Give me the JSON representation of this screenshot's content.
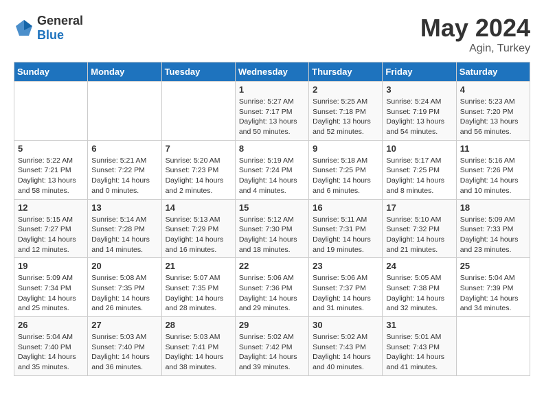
{
  "header": {
    "logo_general": "General",
    "logo_blue": "Blue",
    "title": "May 2024",
    "location": "Agin, Turkey"
  },
  "days_of_week": [
    "Sunday",
    "Monday",
    "Tuesday",
    "Wednesday",
    "Thursday",
    "Friday",
    "Saturday"
  ],
  "weeks": [
    [
      {
        "day": "",
        "sunrise": "",
        "sunset": "",
        "daylight": ""
      },
      {
        "day": "",
        "sunrise": "",
        "sunset": "",
        "daylight": ""
      },
      {
        "day": "",
        "sunrise": "",
        "sunset": "",
        "daylight": ""
      },
      {
        "day": "1",
        "sunrise": "Sunrise: 5:27 AM",
        "sunset": "Sunset: 7:17 PM",
        "daylight": "Daylight: 13 hours and 50 minutes."
      },
      {
        "day": "2",
        "sunrise": "Sunrise: 5:25 AM",
        "sunset": "Sunset: 7:18 PM",
        "daylight": "Daylight: 13 hours and 52 minutes."
      },
      {
        "day": "3",
        "sunrise": "Sunrise: 5:24 AM",
        "sunset": "Sunset: 7:19 PM",
        "daylight": "Daylight: 13 hours and 54 minutes."
      },
      {
        "day": "4",
        "sunrise": "Sunrise: 5:23 AM",
        "sunset": "Sunset: 7:20 PM",
        "daylight": "Daylight: 13 hours and 56 minutes."
      }
    ],
    [
      {
        "day": "5",
        "sunrise": "Sunrise: 5:22 AM",
        "sunset": "Sunset: 7:21 PM",
        "daylight": "Daylight: 13 hours and 58 minutes."
      },
      {
        "day": "6",
        "sunrise": "Sunrise: 5:21 AM",
        "sunset": "Sunset: 7:22 PM",
        "daylight": "Daylight: 14 hours and 0 minutes."
      },
      {
        "day": "7",
        "sunrise": "Sunrise: 5:20 AM",
        "sunset": "Sunset: 7:23 PM",
        "daylight": "Daylight: 14 hours and 2 minutes."
      },
      {
        "day": "8",
        "sunrise": "Sunrise: 5:19 AM",
        "sunset": "Sunset: 7:24 PM",
        "daylight": "Daylight: 14 hours and 4 minutes."
      },
      {
        "day": "9",
        "sunrise": "Sunrise: 5:18 AM",
        "sunset": "Sunset: 7:25 PM",
        "daylight": "Daylight: 14 hours and 6 minutes."
      },
      {
        "day": "10",
        "sunrise": "Sunrise: 5:17 AM",
        "sunset": "Sunset: 7:25 PM",
        "daylight": "Daylight: 14 hours and 8 minutes."
      },
      {
        "day": "11",
        "sunrise": "Sunrise: 5:16 AM",
        "sunset": "Sunset: 7:26 PM",
        "daylight": "Daylight: 14 hours and 10 minutes."
      }
    ],
    [
      {
        "day": "12",
        "sunrise": "Sunrise: 5:15 AM",
        "sunset": "Sunset: 7:27 PM",
        "daylight": "Daylight: 14 hours and 12 minutes."
      },
      {
        "day": "13",
        "sunrise": "Sunrise: 5:14 AM",
        "sunset": "Sunset: 7:28 PM",
        "daylight": "Daylight: 14 hours and 14 minutes."
      },
      {
        "day": "14",
        "sunrise": "Sunrise: 5:13 AM",
        "sunset": "Sunset: 7:29 PM",
        "daylight": "Daylight: 14 hours and 16 minutes."
      },
      {
        "day": "15",
        "sunrise": "Sunrise: 5:12 AM",
        "sunset": "Sunset: 7:30 PM",
        "daylight": "Daylight: 14 hours and 18 minutes."
      },
      {
        "day": "16",
        "sunrise": "Sunrise: 5:11 AM",
        "sunset": "Sunset: 7:31 PM",
        "daylight": "Daylight: 14 hours and 19 minutes."
      },
      {
        "day": "17",
        "sunrise": "Sunrise: 5:10 AM",
        "sunset": "Sunset: 7:32 PM",
        "daylight": "Daylight: 14 hours and 21 minutes."
      },
      {
        "day": "18",
        "sunrise": "Sunrise: 5:09 AM",
        "sunset": "Sunset: 7:33 PM",
        "daylight": "Daylight: 14 hours and 23 minutes."
      }
    ],
    [
      {
        "day": "19",
        "sunrise": "Sunrise: 5:09 AM",
        "sunset": "Sunset: 7:34 PM",
        "daylight": "Daylight: 14 hours and 25 minutes."
      },
      {
        "day": "20",
        "sunrise": "Sunrise: 5:08 AM",
        "sunset": "Sunset: 7:35 PM",
        "daylight": "Daylight: 14 hours and 26 minutes."
      },
      {
        "day": "21",
        "sunrise": "Sunrise: 5:07 AM",
        "sunset": "Sunset: 7:35 PM",
        "daylight": "Daylight: 14 hours and 28 minutes."
      },
      {
        "day": "22",
        "sunrise": "Sunrise: 5:06 AM",
        "sunset": "Sunset: 7:36 PM",
        "daylight": "Daylight: 14 hours and 29 minutes."
      },
      {
        "day": "23",
        "sunrise": "Sunrise: 5:06 AM",
        "sunset": "Sunset: 7:37 PM",
        "daylight": "Daylight: 14 hours and 31 minutes."
      },
      {
        "day": "24",
        "sunrise": "Sunrise: 5:05 AM",
        "sunset": "Sunset: 7:38 PM",
        "daylight": "Daylight: 14 hours and 32 minutes."
      },
      {
        "day": "25",
        "sunrise": "Sunrise: 5:04 AM",
        "sunset": "Sunset: 7:39 PM",
        "daylight": "Daylight: 14 hours and 34 minutes."
      }
    ],
    [
      {
        "day": "26",
        "sunrise": "Sunrise: 5:04 AM",
        "sunset": "Sunset: 7:40 PM",
        "daylight": "Daylight: 14 hours and 35 minutes."
      },
      {
        "day": "27",
        "sunrise": "Sunrise: 5:03 AM",
        "sunset": "Sunset: 7:40 PM",
        "daylight": "Daylight: 14 hours and 36 minutes."
      },
      {
        "day": "28",
        "sunrise": "Sunrise: 5:03 AM",
        "sunset": "Sunset: 7:41 PM",
        "daylight": "Daylight: 14 hours and 38 minutes."
      },
      {
        "day": "29",
        "sunrise": "Sunrise: 5:02 AM",
        "sunset": "Sunset: 7:42 PM",
        "daylight": "Daylight: 14 hours and 39 minutes."
      },
      {
        "day": "30",
        "sunrise": "Sunrise: 5:02 AM",
        "sunset": "Sunset: 7:43 PM",
        "daylight": "Daylight: 14 hours and 40 minutes."
      },
      {
        "day": "31",
        "sunrise": "Sunrise: 5:01 AM",
        "sunset": "Sunset: 7:43 PM",
        "daylight": "Daylight: 14 hours and 41 minutes."
      },
      {
        "day": "",
        "sunrise": "",
        "sunset": "",
        "daylight": ""
      }
    ]
  ]
}
